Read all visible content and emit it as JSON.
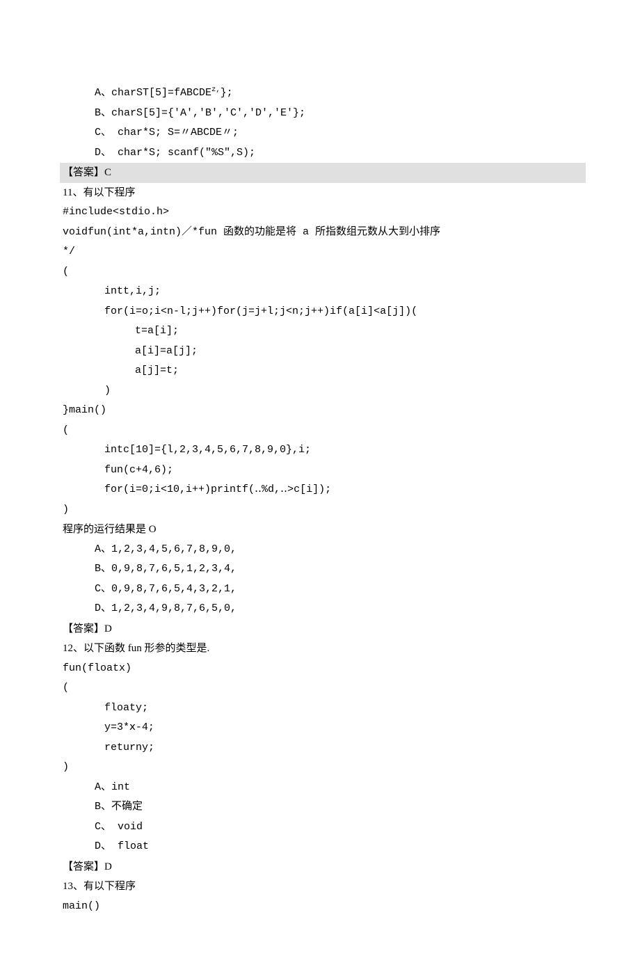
{
  "q10": {
    "options": {
      "a_label": "A、",
      "a_text": "charST[5]=fABCDE",
      "a_sup": "z,",
      "a_tail": "};",
      "b": "B、charS[5]={'A','B','C','D','E'};",
      "c": "C、 char*S; S=〃ABCDE〃;",
      "d": "D、 char*S; scanf(\"%S\",S);"
    },
    "answer": "【答案】C"
  },
  "q11": {
    "head": "11、有以下程序",
    "lines": [
      "#include<stdio.h>",
      "voidfun(int*a,intn)／*fun 函数的功能是将 a 所指数组元数从大到小排序",
      "*/",
      "(",
      "intt,i,j;",
      "for(i=o;i<n-l;j++)for(j=j+l;j<n;j++)if(a[i]<a[j])(",
      "t=a[i];",
      "a[i]=a[j];",
      "a[j]=t;",
      ")",
      "}main()",
      "(",
      "intc[10]={l,2,3,4,5,6,7,8,9,0},i;",
      "fun(c+4,6);",
      "for(i=0;i<10,i++)printf(‥%d,‥>c[i]);",
      ")"
    ],
    "result_label": "程序的运行结果是 O",
    "options": {
      "a": "A、1,2,3,4,5,6,7,8,9,0,",
      "b": "B、0,9,8,7,6,5,1,2,3,4,",
      "c": "C、0,9,8,7,6,5,4,3,2,1,",
      "d": "D、1,2,3,4,9,8,7,6,5,0,"
    },
    "answer": "【答案】D"
  },
  "q12": {
    "head": "12、以下函数 fun 形参的类型是.",
    "lines": [
      "fun(floatx)",
      "(",
      "floaty;",
      "y=3*ⅹ-4;",
      "returny;",
      ")"
    ],
    "options": {
      "a": "A、int",
      "b": "B、不确定",
      "c": "C、 void",
      "d": "D、 float"
    },
    "answer": "【答案】D"
  },
  "q13": {
    "head": "13、有以下程序",
    "lines": [
      "main()"
    ]
  }
}
